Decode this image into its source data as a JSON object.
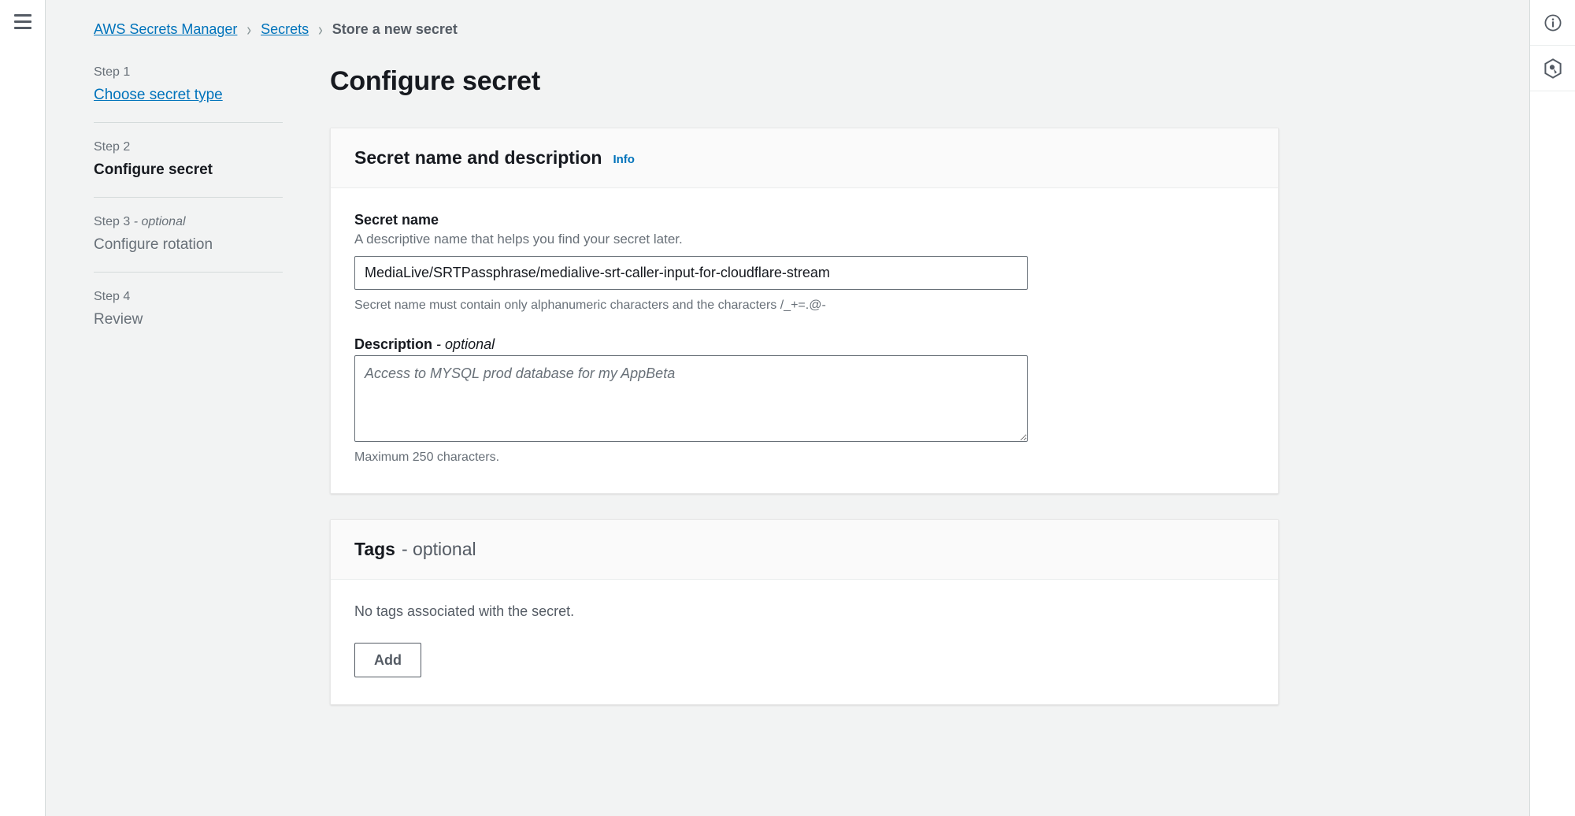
{
  "window": {
    "menu_icon": "hamburger-menu-icon"
  },
  "breadcrumb": {
    "items": [
      {
        "label": "AWS Secrets Manager",
        "type": "link"
      },
      {
        "label": "Secrets",
        "type": "link"
      },
      {
        "label": "Store a new secret",
        "type": "current"
      }
    ],
    "separator": "›"
  },
  "wizard": {
    "steps": [
      {
        "number": "Step 1",
        "optional_suffix": "",
        "label": "Choose secret type",
        "state": "link"
      },
      {
        "number": "Step 2",
        "optional_suffix": "",
        "label": "Configure secret",
        "state": "active"
      },
      {
        "number": "Step 3",
        "optional_suffix": " - optional",
        "label": "Configure rotation",
        "state": "upcoming"
      },
      {
        "number": "Step 4",
        "optional_suffix": "",
        "label": "Review",
        "state": "upcoming"
      }
    ]
  },
  "main": {
    "page_title": "Configure secret",
    "secret_section": {
      "title": "Secret name and description",
      "info_label": "Info",
      "secret_name": {
        "label": "Secret name",
        "description": "A descriptive name that helps you find your secret later.",
        "value": "MediaLive/SRTPassphrase/medialive-srt-caller-input-for-cloudflare-stream",
        "placeholder": "",
        "hint": "Secret name must contain only alphanumeric characters and the characters /_+=.@-"
      },
      "description_field": {
        "label": "Description",
        "optional_suffix": "- optional",
        "value": "",
        "placeholder": "Access to MYSQL prod database for my AppBeta",
        "hint": "Maximum 250 characters."
      }
    },
    "tags_section": {
      "title": "Tags",
      "optional_suffix": "- optional",
      "empty_message": "No tags associated with the secret.",
      "add_button": "Add"
    }
  },
  "right_rail": {
    "buttons": [
      {
        "icon": "info-circle-icon",
        "name": "help-panel-toggle"
      },
      {
        "icon": "security-shield-icon",
        "name": "security-panel-toggle"
      }
    ]
  },
  "colors": {
    "link": "#0073bb",
    "text": "#16191f",
    "muted": "#687078",
    "page_bg": "#f2f3f3",
    "card_bg": "#ffffff",
    "card_header_bg": "#fafafa",
    "border": "#d5dbdb"
  }
}
